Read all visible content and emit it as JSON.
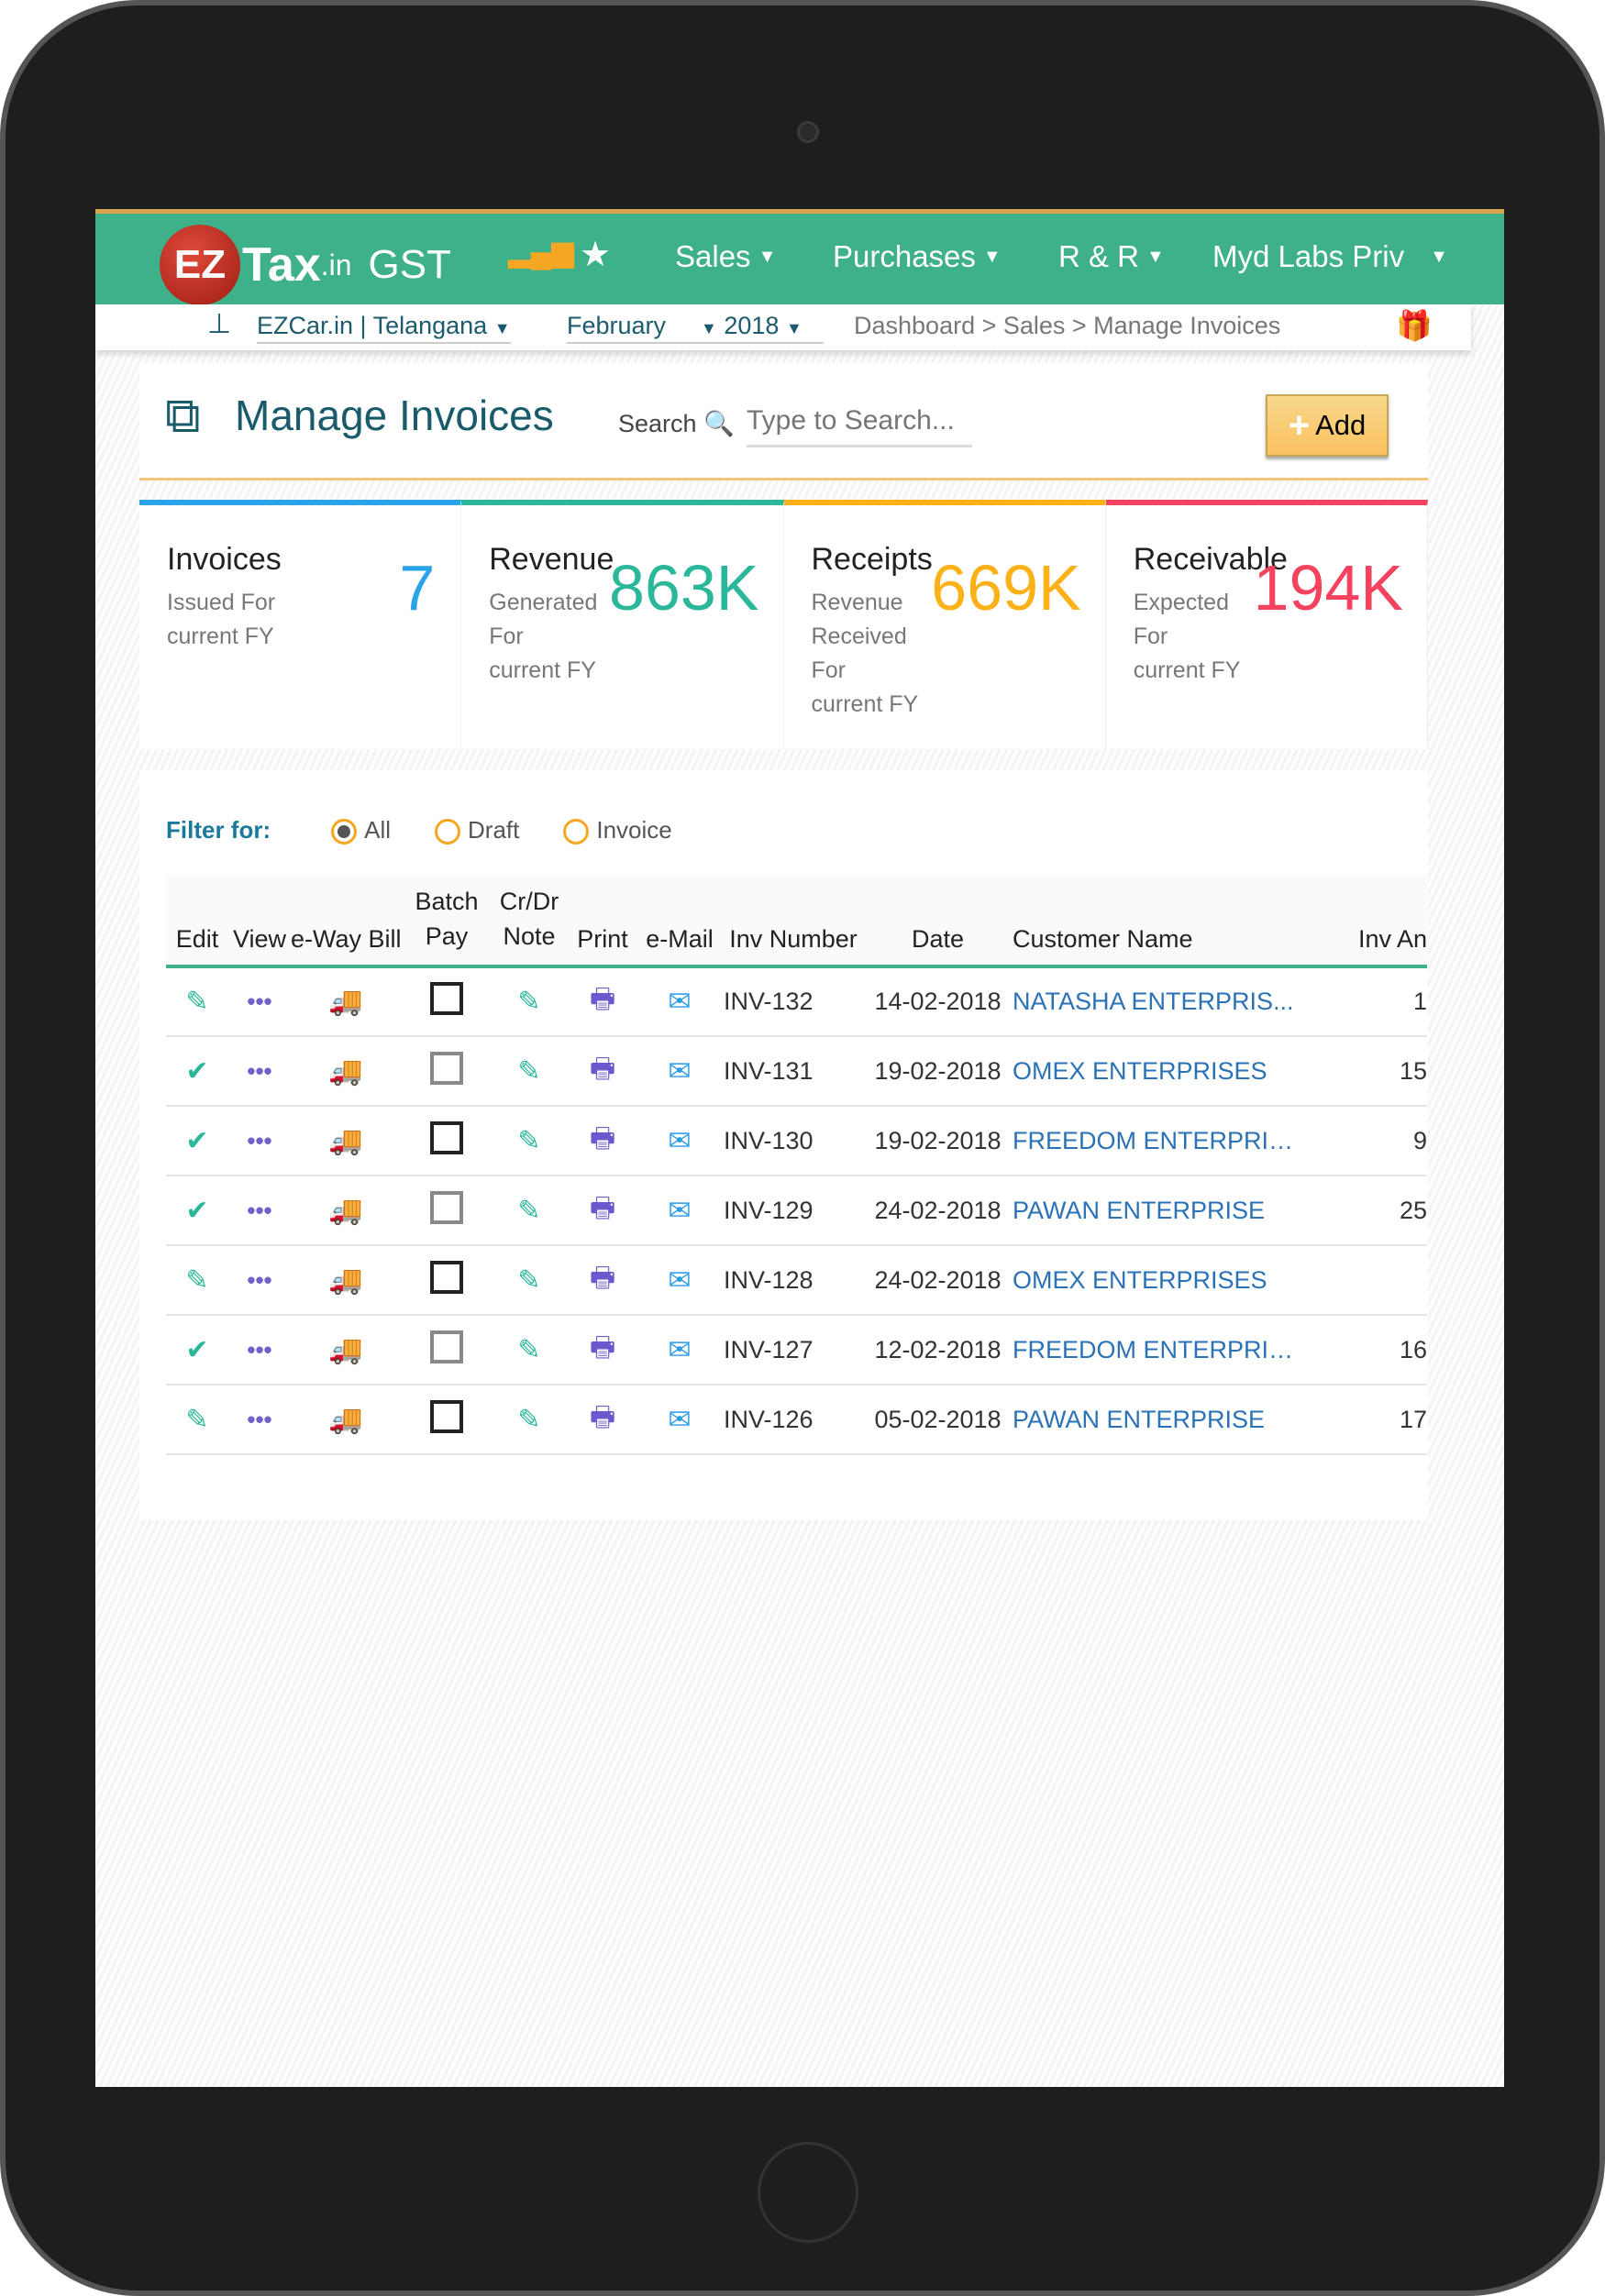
{
  "header": {
    "logo_ez": "EZ",
    "logo_tax": "Tax",
    "logo_in": ".in",
    "logo_gst": "GST",
    "nav": [
      "Sales",
      "Purchases",
      "R & R",
      "Myd Labs Priv"
    ]
  },
  "subbar": {
    "company": "EZCar.in | Telangana",
    "month": "February",
    "year": "2018",
    "breadcrumb": "Dashboard > Sales > Manage Invoices"
  },
  "page": {
    "title": "Manage Invoices",
    "search_label": "Search",
    "search_placeholder": "Type to Search...",
    "add_label": "Add"
  },
  "stats": [
    {
      "title": "Invoices",
      "desc": "Issued For current FY",
      "value": "7",
      "color": "#2aa3e8"
    },
    {
      "title": "Revenue",
      "desc": "Generated For current FY",
      "value": "863K",
      "color": "#2bb79a"
    },
    {
      "title": "Receipts",
      "desc": "Revenue Received For current FY",
      "value": "669K",
      "color": "#fbb117"
    },
    {
      "title": "Receivable",
      "desc": "Expected For current FY",
      "value": "194K",
      "color": "#f5425f"
    }
  ],
  "filter": {
    "label": "Filter for:",
    "options": [
      "All",
      "Draft",
      "Invoice"
    ],
    "selected": "All"
  },
  "table": {
    "headers": [
      "Edit",
      "View",
      "e-Way Bill",
      "Batch Pay",
      "Cr/Dr Note",
      "Print",
      "e-Mail",
      "Inv Number",
      "Date",
      "Customer Name",
      "Inv An"
    ],
    "rows": [
      {
        "status": "edit",
        "batch_dark": true,
        "inv": "INV-132",
        "date": "14-02-2018",
        "customer": "NATASHA ENTERPRIS...",
        "amount": "1"
      },
      {
        "status": "check",
        "batch_dark": false,
        "inv": "INV-131",
        "date": "19-02-2018",
        "customer": "OMEX ENTERPRISES",
        "amount": "15"
      },
      {
        "status": "check",
        "batch_dark": true,
        "inv": "INV-130",
        "date": "19-02-2018",
        "customer": "FREEDOM ENTERPRIS...",
        "amount": "9"
      },
      {
        "status": "check",
        "batch_dark": false,
        "inv": "INV-129",
        "date": "24-02-2018",
        "customer": "PAWAN ENTERPRISE",
        "amount": "25"
      },
      {
        "status": "edit",
        "batch_dark": true,
        "inv": "INV-128",
        "date": "24-02-2018",
        "customer": "OMEX ENTERPRISES",
        "amount": ""
      },
      {
        "status": "check",
        "batch_dark": false,
        "inv": "INV-127",
        "date": "12-02-2018",
        "customer": "FREEDOM ENTERPRIS...",
        "amount": "16"
      },
      {
        "status": "edit",
        "batch_dark": true,
        "inv": "INV-126",
        "date": "05-02-2018",
        "customer": "PAWAN ENTERPRISE",
        "amount": "17"
      }
    ]
  }
}
